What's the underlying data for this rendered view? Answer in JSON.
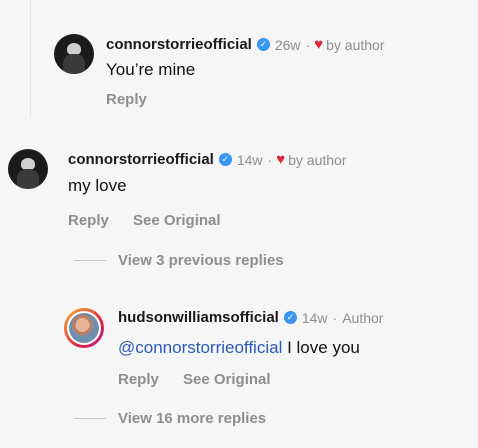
{
  "comments": [
    {
      "username": "connorstorrieofficial",
      "time": "26w",
      "liked_by": "by author",
      "text": "You’re mine",
      "actions": [
        "Reply"
      ]
    },
    {
      "username": "connorstorrieofficial",
      "time": "14w",
      "liked_by": "by author",
      "text": "my love",
      "actions": [
        "Reply",
        "See Original"
      ]
    },
    {
      "username": "hudsonwilliamsofficial",
      "time": "14w",
      "role": "Author",
      "mention": "@connorstorrieofficial",
      "text": " I love you",
      "actions": [
        "Reply",
        "See Original"
      ]
    }
  ],
  "view_previous": "View 3 previous replies",
  "view_more": "View 16 more replies",
  "separator": "·",
  "verified_mark": "✓",
  "heart_icon": "♥",
  "colors": {
    "verified": "#3897f0",
    "heart": "#e0243a",
    "mention": "#2b5bb5"
  }
}
